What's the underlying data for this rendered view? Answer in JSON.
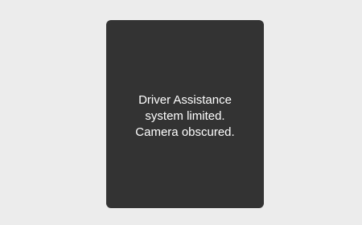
{
  "colors": {
    "background": "#ececec",
    "panel": "#333333",
    "text": "#ffffff"
  },
  "alert": {
    "lines": [
      "Driver Assistance",
      "system limited.",
      "Camera obscured."
    ]
  }
}
